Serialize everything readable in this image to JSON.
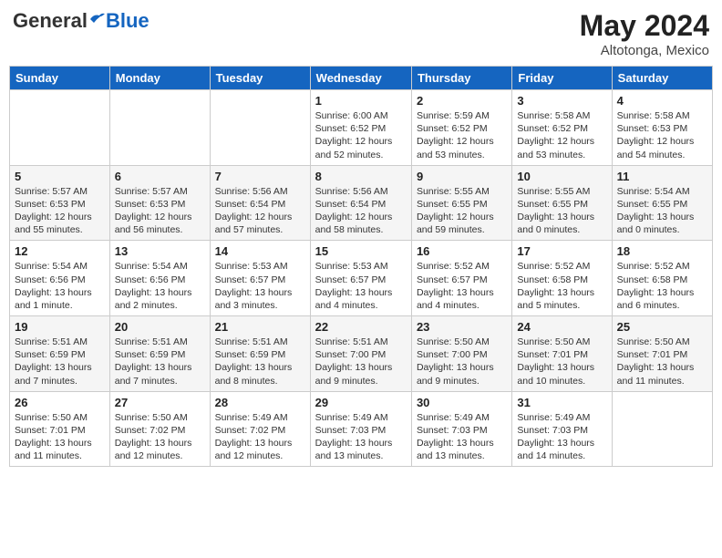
{
  "header": {
    "logo_general": "General",
    "logo_blue": "Blue",
    "month_year": "May 2024",
    "location": "Altotonga, Mexico"
  },
  "weekdays": [
    "Sunday",
    "Monday",
    "Tuesday",
    "Wednesday",
    "Thursday",
    "Friday",
    "Saturday"
  ],
  "weeks": [
    [
      {
        "day": "",
        "info": ""
      },
      {
        "day": "",
        "info": ""
      },
      {
        "day": "",
        "info": ""
      },
      {
        "day": "1",
        "info": "Sunrise: 6:00 AM\nSunset: 6:52 PM\nDaylight: 12 hours\nand 52 minutes."
      },
      {
        "day": "2",
        "info": "Sunrise: 5:59 AM\nSunset: 6:52 PM\nDaylight: 12 hours\nand 53 minutes."
      },
      {
        "day": "3",
        "info": "Sunrise: 5:58 AM\nSunset: 6:52 PM\nDaylight: 12 hours\nand 53 minutes."
      },
      {
        "day": "4",
        "info": "Sunrise: 5:58 AM\nSunset: 6:53 PM\nDaylight: 12 hours\nand 54 minutes."
      }
    ],
    [
      {
        "day": "5",
        "info": "Sunrise: 5:57 AM\nSunset: 6:53 PM\nDaylight: 12 hours\nand 55 minutes."
      },
      {
        "day": "6",
        "info": "Sunrise: 5:57 AM\nSunset: 6:53 PM\nDaylight: 12 hours\nand 56 minutes."
      },
      {
        "day": "7",
        "info": "Sunrise: 5:56 AM\nSunset: 6:54 PM\nDaylight: 12 hours\nand 57 minutes."
      },
      {
        "day": "8",
        "info": "Sunrise: 5:56 AM\nSunset: 6:54 PM\nDaylight: 12 hours\nand 58 minutes."
      },
      {
        "day": "9",
        "info": "Sunrise: 5:55 AM\nSunset: 6:55 PM\nDaylight: 12 hours\nand 59 minutes."
      },
      {
        "day": "10",
        "info": "Sunrise: 5:55 AM\nSunset: 6:55 PM\nDaylight: 13 hours\nand 0 minutes."
      },
      {
        "day": "11",
        "info": "Sunrise: 5:54 AM\nSunset: 6:55 PM\nDaylight: 13 hours\nand 0 minutes."
      }
    ],
    [
      {
        "day": "12",
        "info": "Sunrise: 5:54 AM\nSunset: 6:56 PM\nDaylight: 13 hours\nand 1 minute."
      },
      {
        "day": "13",
        "info": "Sunrise: 5:54 AM\nSunset: 6:56 PM\nDaylight: 13 hours\nand 2 minutes."
      },
      {
        "day": "14",
        "info": "Sunrise: 5:53 AM\nSunset: 6:57 PM\nDaylight: 13 hours\nand 3 minutes."
      },
      {
        "day": "15",
        "info": "Sunrise: 5:53 AM\nSunset: 6:57 PM\nDaylight: 13 hours\nand 4 minutes."
      },
      {
        "day": "16",
        "info": "Sunrise: 5:52 AM\nSunset: 6:57 PM\nDaylight: 13 hours\nand 4 minutes."
      },
      {
        "day": "17",
        "info": "Sunrise: 5:52 AM\nSunset: 6:58 PM\nDaylight: 13 hours\nand 5 minutes."
      },
      {
        "day": "18",
        "info": "Sunrise: 5:52 AM\nSunset: 6:58 PM\nDaylight: 13 hours\nand 6 minutes."
      }
    ],
    [
      {
        "day": "19",
        "info": "Sunrise: 5:51 AM\nSunset: 6:59 PM\nDaylight: 13 hours\nand 7 minutes."
      },
      {
        "day": "20",
        "info": "Sunrise: 5:51 AM\nSunset: 6:59 PM\nDaylight: 13 hours\nand 7 minutes."
      },
      {
        "day": "21",
        "info": "Sunrise: 5:51 AM\nSunset: 6:59 PM\nDaylight: 13 hours\nand 8 minutes."
      },
      {
        "day": "22",
        "info": "Sunrise: 5:51 AM\nSunset: 7:00 PM\nDaylight: 13 hours\nand 9 minutes."
      },
      {
        "day": "23",
        "info": "Sunrise: 5:50 AM\nSunset: 7:00 PM\nDaylight: 13 hours\nand 9 minutes."
      },
      {
        "day": "24",
        "info": "Sunrise: 5:50 AM\nSunset: 7:01 PM\nDaylight: 13 hours\nand 10 minutes."
      },
      {
        "day": "25",
        "info": "Sunrise: 5:50 AM\nSunset: 7:01 PM\nDaylight: 13 hours\nand 11 minutes."
      }
    ],
    [
      {
        "day": "26",
        "info": "Sunrise: 5:50 AM\nSunset: 7:01 PM\nDaylight: 13 hours\nand 11 minutes."
      },
      {
        "day": "27",
        "info": "Sunrise: 5:50 AM\nSunset: 7:02 PM\nDaylight: 13 hours\nand 12 minutes."
      },
      {
        "day": "28",
        "info": "Sunrise: 5:49 AM\nSunset: 7:02 PM\nDaylight: 13 hours\nand 12 minutes."
      },
      {
        "day": "29",
        "info": "Sunrise: 5:49 AM\nSunset: 7:03 PM\nDaylight: 13 hours\nand 13 minutes."
      },
      {
        "day": "30",
        "info": "Sunrise: 5:49 AM\nSunset: 7:03 PM\nDaylight: 13 hours\nand 13 minutes."
      },
      {
        "day": "31",
        "info": "Sunrise: 5:49 AM\nSunset: 7:03 PM\nDaylight: 13 hours\nand 14 minutes."
      },
      {
        "day": "",
        "info": ""
      }
    ]
  ]
}
